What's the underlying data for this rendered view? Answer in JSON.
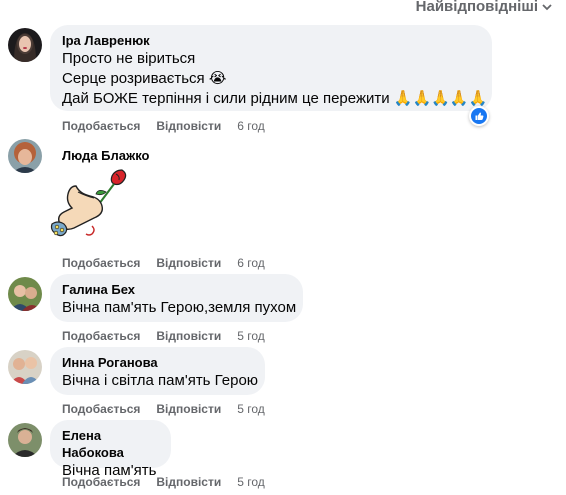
{
  "sort": {
    "label": "Найвідповідніші"
  },
  "comments": [
    {
      "author": "Іра Лавренюк",
      "lines": [
        "Просто не віриться",
        "Серце розривається 😭",
        "Дай БОЖЕ терпіння і сили рідним це пережити 🙏🙏🙏🙏🙏"
      ],
      "like": "Подобається",
      "reply": "Відповісти",
      "time": "6 год",
      "reaction": "like-reaction-icon",
      "avatar_color": "#3b2f2a"
    },
    {
      "author": "Люда Блажко",
      "like": "Подобається",
      "reply": "Відповісти",
      "time": "6 год",
      "sticker": "rose-in-hand-sticker",
      "avatar_color": "#b5623a"
    },
    {
      "author": "Галина Бех",
      "lines": [
        "Вічна пам'ять Герою,земля пухом"
      ],
      "like": "Подобається",
      "reply": "Відповісти",
      "time": "5 год",
      "avatar_color": "#4f6a3a"
    },
    {
      "author": "Инна Роганова",
      "lines": [
        "Вічна і світла пам'ять Герою"
      ],
      "like": "Подобається",
      "reply": "Відповісти",
      "time": "5 год",
      "avatar_color": "#c97a6b"
    },
    {
      "author": "Елена Набокова",
      "lines": [
        "Вічна пам'ять"
      ],
      "like": "Подобається",
      "reply": "Відповісти",
      "time": "5 год",
      "avatar_color": "#6b7b5a"
    }
  ]
}
